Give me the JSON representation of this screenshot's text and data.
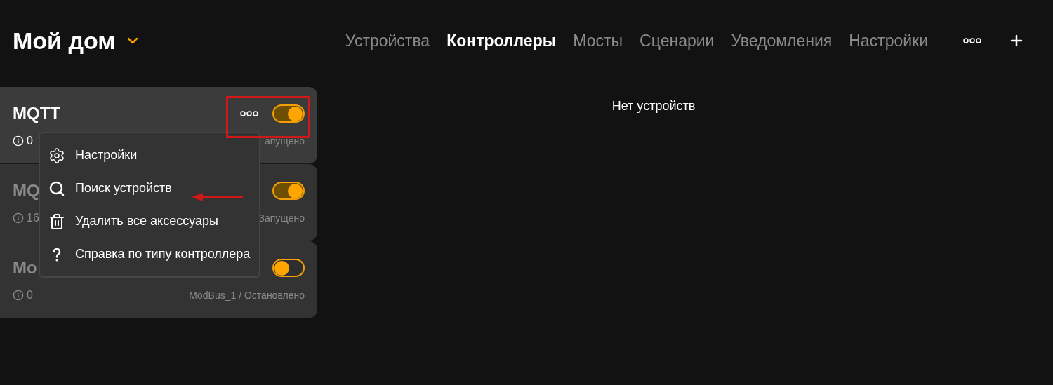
{
  "home": {
    "title": "Мой дом"
  },
  "tabs": [
    {
      "label": "Устройства",
      "selected": false
    },
    {
      "label": "Контроллеры",
      "selected": true
    },
    {
      "label": "Мосты",
      "selected": false
    },
    {
      "label": "Сценарии",
      "selected": false
    },
    {
      "label": "Уведомления",
      "selected": false
    },
    {
      "label": "Настройки",
      "selected": false
    }
  ],
  "controllers": [
    {
      "title": "MQTT",
      "count": "0",
      "status": "апущено",
      "selected": true,
      "on": true
    },
    {
      "title": "MQ",
      "count": "16",
      "status": "Запущено",
      "selected": false,
      "on": true
    },
    {
      "title": "Mo",
      "count": "0",
      "status": "ModBus_1 / Остановлено",
      "selected": false,
      "on": false
    }
  ],
  "menu": [
    {
      "kind": "gear",
      "label": "Настройки"
    },
    {
      "kind": "search",
      "label": "Поиск устройств"
    },
    {
      "kind": "trash",
      "label": "Удалить все аксессуары"
    },
    {
      "kind": "help",
      "label": "Справка по типу контроллера"
    }
  ],
  "empty_message": "Нет устройств"
}
